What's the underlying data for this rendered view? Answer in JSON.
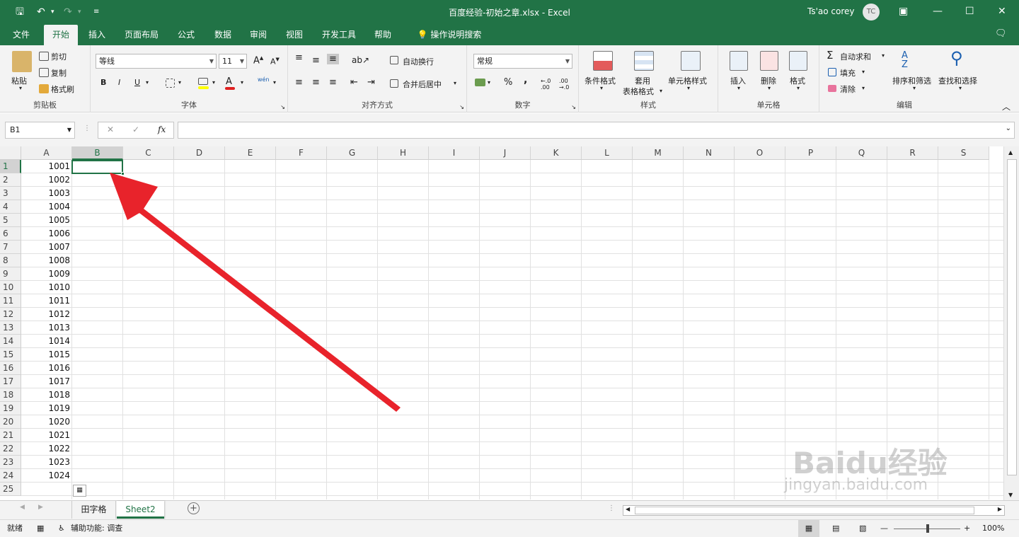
{
  "window": {
    "title": "百度经验-初始之章.xlsx  -  Excel",
    "user_name": "Ts'ao corey",
    "user_initials": "TC"
  },
  "tabs": [
    "文件",
    "开始",
    "插入",
    "页面布局",
    "公式",
    "数据",
    "审阅",
    "视图",
    "开发工具",
    "帮助"
  ],
  "tell_me": "操作说明搜索",
  "clipboard": {
    "paste": "粘贴",
    "cut": "剪切",
    "copy": "复制",
    "format_painter": "格式刷",
    "label": "剪贴板"
  },
  "font": {
    "name": "等线",
    "size": "11",
    "bold": "B",
    "italic": "I",
    "underline": "U",
    "label": "字体"
  },
  "alignment": {
    "wrap": "自动换行",
    "merge": "合并后居中",
    "label": "对齐方式"
  },
  "number": {
    "format": "常规",
    "percent": "%",
    "comma": ",",
    "label": "数字"
  },
  "styles": {
    "conditional": "条件格式",
    "table_line1": "套用",
    "table_line2": "表格格式",
    "cell_styles": "单元格样式",
    "label": "样式"
  },
  "cells": {
    "insert": "插入",
    "delete": "删除",
    "format": "格式",
    "label": "单元格"
  },
  "editing": {
    "autosum": "自动求和",
    "fill": "填充",
    "clear": "清除",
    "sort": "排序和筛选",
    "find": "查找和选择",
    "label": "编辑"
  },
  "formula_bar": {
    "name_box": "B1",
    "fx": "fx",
    "cancel": "✕",
    "enter": "✓",
    "value": ""
  },
  "columns": [
    "A",
    "B",
    "C",
    "D",
    "E",
    "F",
    "G",
    "H",
    "I",
    "J",
    "K",
    "L",
    "M",
    "N",
    "O",
    "P",
    "Q",
    "R",
    "S"
  ],
  "selected_cell": "B1",
  "rows": [
    {
      "n": "1",
      "a": "1001"
    },
    {
      "n": "2",
      "a": "1002"
    },
    {
      "n": "3",
      "a": "1003"
    },
    {
      "n": "4",
      "a": "1004"
    },
    {
      "n": "5",
      "a": "1005"
    },
    {
      "n": "6",
      "a": "1006"
    },
    {
      "n": "7",
      "a": "1007"
    },
    {
      "n": "8",
      "a": "1008"
    },
    {
      "n": "9",
      "a": "1009"
    },
    {
      "n": "10",
      "a": "1010"
    },
    {
      "n": "11",
      "a": "1011"
    },
    {
      "n": "12",
      "a": "1012"
    },
    {
      "n": "13",
      "a": "1013"
    },
    {
      "n": "14",
      "a": "1014"
    },
    {
      "n": "15",
      "a": "1015"
    },
    {
      "n": "16",
      "a": "1016"
    },
    {
      "n": "17",
      "a": "1017"
    },
    {
      "n": "18",
      "a": "1018"
    },
    {
      "n": "19",
      "a": "1019"
    },
    {
      "n": "20",
      "a": "1020"
    },
    {
      "n": "21",
      "a": "1021"
    },
    {
      "n": "22",
      "a": "1022"
    },
    {
      "n": "23",
      "a": "1023"
    },
    {
      "n": "24",
      "a": "1024"
    },
    {
      "n": "25",
      "a": ""
    }
  ],
  "sheet_tabs": [
    {
      "name": "田字格",
      "active": false
    },
    {
      "name": "Sheet2",
      "active": true
    }
  ],
  "status": {
    "ready": "就绪",
    "accessibility": "辅助功能: 调查",
    "zoom": "100%"
  },
  "watermark": "Baidu经验",
  "watermark_url": "jingyan.baidu.com",
  "colors": {
    "accent": "#217346",
    "arrow": "#e8232b"
  }
}
